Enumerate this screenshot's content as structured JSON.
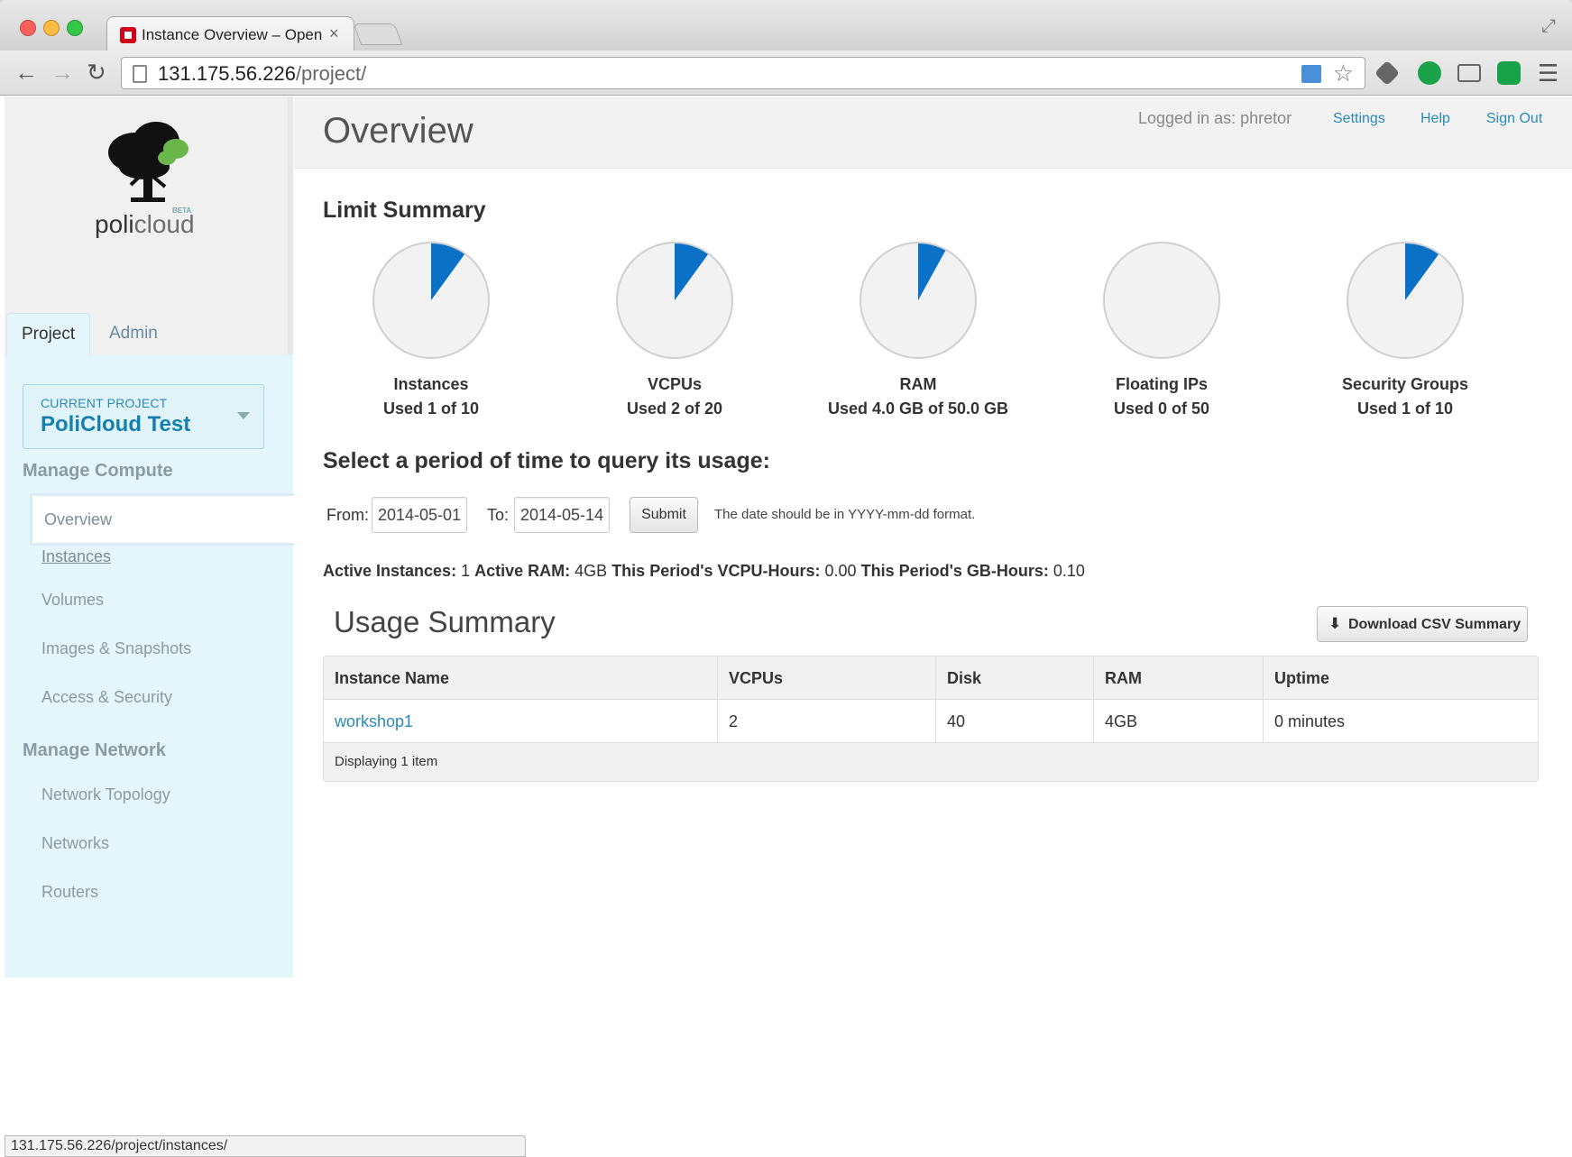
{
  "browser": {
    "tab_title": "Instance Overview – OpenStack",
    "tab_close": "×",
    "url_host": "131.175.56.226",
    "url_path": "/project/",
    "status_url": "131.175.56.226/project/instances/"
  },
  "sidebar": {
    "brand_a": "poli",
    "brand_b": "cloud",
    "beta": "BETA",
    "tabs": {
      "project": "Project",
      "admin": "Admin"
    },
    "current_project_caption": "CURRENT PROJECT",
    "current_project_name": "PoliCloud Test",
    "compute_heading": "Manage Compute",
    "compute_items": [
      "Overview",
      "Instances",
      "Volumes",
      "Images & Snapshots",
      "Access & Security"
    ],
    "network_heading": "Manage Network",
    "network_items": [
      "Network Topology",
      "Networks",
      "Routers"
    ]
  },
  "header": {
    "title": "Overview",
    "logged_in": "Logged in as: phretor",
    "settings": "Settings",
    "help": "Help",
    "sign_out": "Sign Out"
  },
  "limit_summary": {
    "heading": "Limit Summary",
    "items": [
      {
        "name": "Instances",
        "usage": "Used 1 of 10",
        "fraction": 0.1
      },
      {
        "name": "VCPUs",
        "usage": "Used 2 of 20",
        "fraction": 0.1
      },
      {
        "name": "RAM",
        "usage": "Used 4.0 GB of 50.0 GB",
        "fraction": 0.08
      },
      {
        "name": "Floating IPs",
        "usage": "Used 0 of 50",
        "fraction": 0
      },
      {
        "name": "Security Groups",
        "usage": "Used 1 of 10",
        "fraction": 0.1
      }
    ]
  },
  "query": {
    "heading": "Select a period of time to query its usage:",
    "from_label": "From:",
    "from_value": "2014-05-01",
    "to_label": "To:",
    "to_value": "2014-05-14",
    "submit": "Submit",
    "hint": "The date should be in YYYY-mm-dd format."
  },
  "stats": {
    "active_instances_label": "Active Instances:",
    "active_instances": "1",
    "active_ram_label": "Active RAM:",
    "active_ram": "4GB",
    "vcpu_hours_label": "This Period's VCPU-Hours:",
    "vcpu_hours": "0.00",
    "gb_hours_label": "This Period's GB-Hours:",
    "gb_hours": "0.10"
  },
  "usage": {
    "title": "Usage Summary",
    "csv_button": "Download CSV Summary",
    "columns": [
      "Instance Name",
      "VCPUs",
      "Disk",
      "RAM",
      "Uptime"
    ],
    "rows": [
      [
        "workshop1",
        "2",
        "40",
        "4GB",
        "0 minutes"
      ]
    ],
    "footer": "Displaying 1 item"
  },
  "colors": {
    "accent": "#2a8ab5",
    "pie_fill": "#0a71c7",
    "pie_bg": "#f2f2f2"
  }
}
